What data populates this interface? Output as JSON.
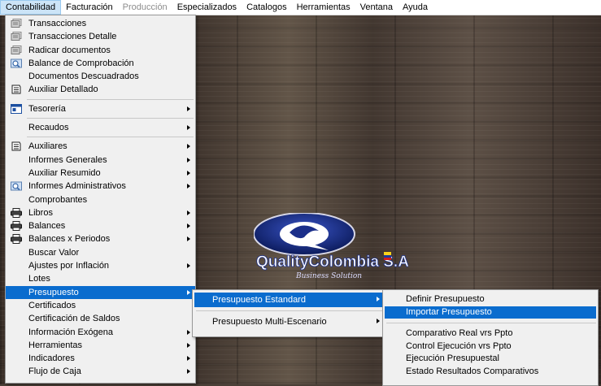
{
  "menubar": {
    "items": [
      {
        "label": "Contabilidad",
        "state": "active"
      },
      {
        "label": "Facturación",
        "state": "normal"
      },
      {
        "label": "Producción",
        "state": "disabled"
      },
      {
        "label": "Especializados",
        "state": "normal"
      },
      {
        "label": "Catalogos",
        "state": "normal"
      },
      {
        "label": "Herramientas",
        "state": "normal"
      },
      {
        "label": "Ventana",
        "state": "normal"
      },
      {
        "label": "Ayuda",
        "state": "normal"
      }
    ]
  },
  "contabilidad_menu": {
    "items": [
      {
        "label": "Transacciones",
        "icon": "documents-icon"
      },
      {
        "label": "Transacciones Detalle",
        "icon": "documents-icon"
      },
      {
        "label": "Radicar documentos",
        "icon": "documents-icon"
      },
      {
        "label": "Balance de Comprobación",
        "icon": "magnifier-icon"
      },
      {
        "label": "Documentos Descuadrados",
        "icon": ""
      },
      {
        "label": "Auxiliar Detallado",
        "icon": "ledger-icon"
      },
      {
        "label": "Tesorería",
        "icon": "window-icon",
        "submenu": true
      },
      {
        "label": "Recaudos",
        "icon": "",
        "submenu": true
      },
      {
        "label": "Auxiliares",
        "icon": "ledger-icon",
        "submenu": true
      },
      {
        "label": "Informes Generales",
        "icon": "",
        "submenu": true
      },
      {
        "label": "Auxiliar Resumido",
        "icon": "",
        "submenu": true
      },
      {
        "label": "Informes Administrativos",
        "icon": "magnifier-icon",
        "submenu": true
      },
      {
        "label": "Comprobantes",
        "icon": ""
      },
      {
        "label": "Libros",
        "icon": "printer-icon",
        "submenu": true
      },
      {
        "label": "Balances",
        "icon": "printer-icon",
        "submenu": true
      },
      {
        "label": "Balances x Periodos",
        "icon": "printer-icon",
        "submenu": true
      },
      {
        "label": "Buscar Valor",
        "icon": ""
      },
      {
        "label": "Ajustes por Inflación",
        "icon": "",
        "submenu": true
      },
      {
        "label": "Lotes",
        "icon": ""
      },
      {
        "label": "Presupuesto",
        "icon": "",
        "submenu": true,
        "highlighted": true
      },
      {
        "label": "Certificados",
        "icon": ""
      },
      {
        "label": "Certificación de Saldos",
        "icon": ""
      },
      {
        "label": "Información Exógena",
        "icon": "",
        "submenu": true
      },
      {
        "label": "Herramientas",
        "icon": "",
        "submenu": true
      },
      {
        "label": "Indicadores",
        "icon": "",
        "submenu": true
      },
      {
        "label": "Flujo de Caja",
        "icon": "",
        "submenu": true
      }
    ]
  },
  "presupuesto_menu": {
    "items": [
      {
        "label": "Presupuesto  Estandard",
        "submenu": true,
        "highlighted": true
      },
      {
        "label": "Presupuesto Multi-Escenario",
        "submenu": true
      }
    ]
  },
  "estandard_menu": {
    "items": [
      {
        "label": "Definir Presupuesto"
      },
      {
        "label": "Importar Presupuesto",
        "highlighted": true
      },
      {
        "label": "Comparativo  Real vrs Ppto"
      },
      {
        "label": "Control Ejecución vrs Ppto"
      },
      {
        "label": "Ejecución Presupuestal"
      },
      {
        "label": "Estado Resultados Comparativos"
      }
    ]
  },
  "logo": {
    "brand": "QualityColombia S.A.",
    "tagline": "Business Solution"
  },
  "colors": {
    "highlight": "#0a6cce",
    "menubar_active": "#cce4f7"
  }
}
